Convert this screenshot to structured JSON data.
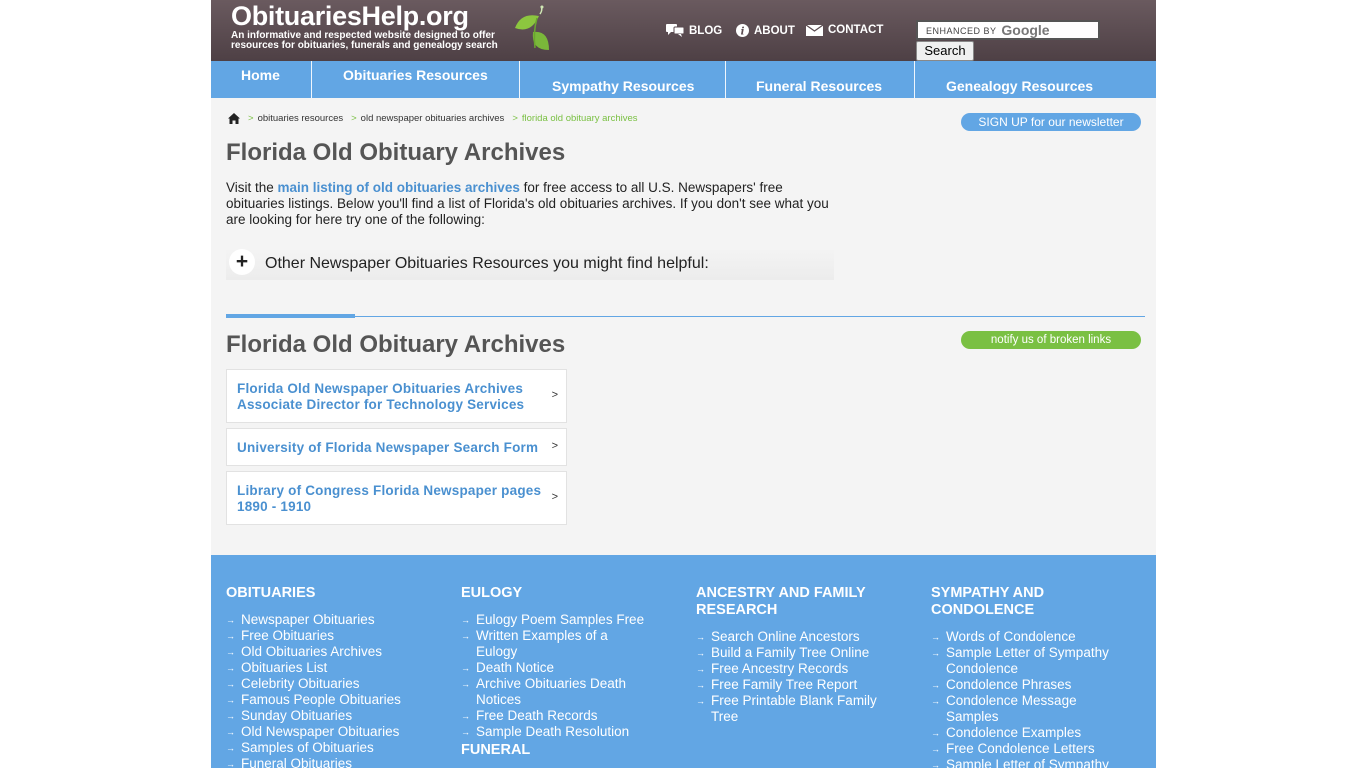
{
  "header": {
    "logo": "ObituariesHelp.org",
    "tagline": "An informative and respected website designed to offer resources for obituaries, funerals and genealogy search",
    "links": [
      {
        "label": "BLOG",
        "icon": "chat-bubbles-icon"
      },
      {
        "label": "ABOUT",
        "icon": "info-icon"
      },
      {
        "label": "CONTACT",
        "icon": "envelope-icon"
      }
    ],
    "search_prefix": "ENHANCED BY",
    "search_brand": "Google",
    "search_button": "Search"
  },
  "nav": [
    "Home",
    "Obituaries Resources",
    "Sympathy Resources",
    "Funeral Resources",
    "Genealogy Resources"
  ],
  "breadcrumb": {
    "items": [
      "obituaries resources",
      "old newspaper obituaries archives"
    ],
    "current": "florida old obituary archives",
    "separator": ">"
  },
  "newsletter_button": "SIGN UP for our newsletter",
  "page_title": "Florida Old Obituary Archives",
  "intro": {
    "before": "Visit the ",
    "link": "main listing of old obituaries archives",
    "after": " for free access to all U.S. Newspapers' free obituaries listings. Below you'll find a list of Florida's old obituaries archives. If you don't see what you are looking for here try one of the following:"
  },
  "accordion": {
    "toggle": "+",
    "label": "Other Newspaper Obituaries Resources you might find helpful:"
  },
  "section_title": "Florida Old Obituary Archives",
  "notify_button": "notify us of broken links",
  "archive_links": [
    {
      "line1": "Florida Old Newspaper Obituaries Archives",
      "line2": "Associate Director for Technology Services"
    },
    {
      "line1": "University of Florida Newspaper Search Form",
      "line2": ""
    },
    {
      "line1": "Library of Congress Florida Newspaper pages",
      "line2": "1890 - 1910"
    }
  ],
  "arrow": ">",
  "footer": {
    "obituaries": {
      "head": "OBITUARIES",
      "items": [
        "Newspaper Obituaries",
        "Free Obituaries",
        "Old Obituaries Archives",
        "Obituaries List",
        "Celebrity Obituaries",
        "Famous People Obituaries",
        "Sunday Obituaries",
        "Old Newspaper Obituaries",
        "Samples of Obituaries",
        "Funeral Obituaries"
      ]
    },
    "eulogy": {
      "head": "EULOGY",
      "items": [
        "Eulogy Poem Samples Free",
        "Written Examples of a Eulogy",
        "Death Notice",
        "Archive Obituaries Death Notices",
        "Free Death Records",
        "Sample Death Resolution"
      ],
      "next_head": "FUNERAL"
    },
    "ancestry": {
      "head": "ANCESTRY AND FAMILY RESEARCH",
      "items": [
        "Search Online Ancestors",
        "Build a Family Tree Online",
        "Free Ancestry Records",
        "Free Family Tree Report",
        "Free Printable Blank Family Tree"
      ]
    },
    "sympathy": {
      "head": "SYMPATHY AND CONDOLENCE",
      "items": [
        "Words of Condolence",
        "Sample Letter of Sympathy Condolence",
        "Condolence Phrases",
        "Condolence Message Samples",
        "Condolence Examples",
        "Free Condolence Letters",
        "Sample Letter of Sympathy"
      ]
    }
  },
  "colors": {
    "header": "#5a4a4f",
    "nav": "#62a6e4",
    "green": "#7ac043",
    "link": "#4a90d0",
    "footer": "#62a6e4"
  }
}
